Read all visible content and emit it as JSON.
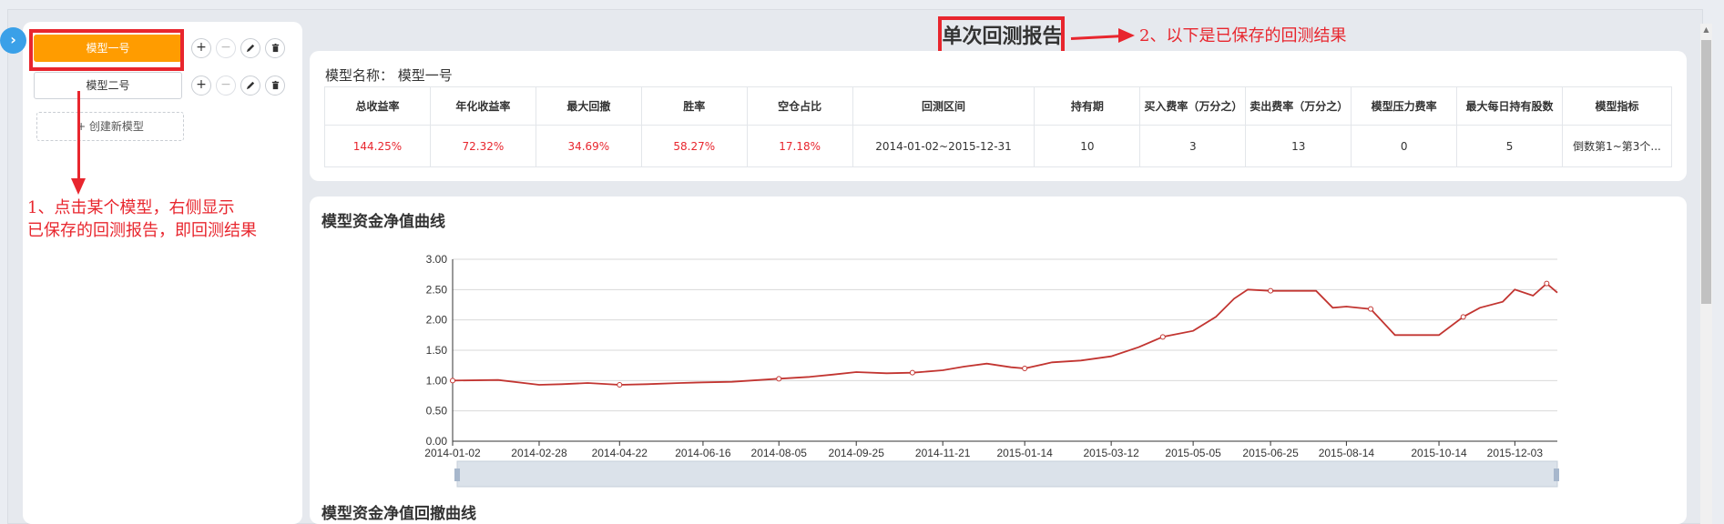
{
  "sidebar": {
    "models": [
      {
        "label": "模型一号",
        "active": true
      },
      {
        "label": "模型二号",
        "active": false
      }
    ],
    "create_label": "+ 创建新模型"
  },
  "annotations": {
    "left_line1": "1、点击某个模型，右侧显示",
    "left_line2": "已保存的回测报告，即回测结果",
    "top": "2、以下是已保存的回测结果"
  },
  "page_title": "单次回测报告",
  "report": {
    "model_name_label": "模型名称：",
    "model_name_value": "模型一号",
    "headers": [
      "总收益率",
      "年化收益率",
      "最大回撤",
      "胜率",
      "空仓占比",
      "回测区间",
      "持有期",
      "买入费率（万分之）",
      "卖出费率（万分之）",
      "模型压力费率",
      "最大每日持有股数",
      "模型指标"
    ],
    "values": [
      "144.25%",
      "72.32%",
      "34.69%",
      "58.27%",
      "17.18%",
      "2014-01-02~2015-12-31",
      "10",
      "3",
      "13",
      "0",
      "5",
      "倒数第1~第3个..."
    ]
  },
  "chart_title": "模型资金净值曲线",
  "drawdown_title": "模型资金净值回撤曲线",
  "colors": {
    "accent": "#ff9c00",
    "line": "#c23531",
    "annotation": "#e8262e",
    "toggle": "#3aa0e8"
  },
  "chart_data": {
    "type": "line",
    "title": "模型资金净值曲线",
    "xlabel": "",
    "ylabel": "",
    "ylim": [
      0,
      3
    ],
    "yticks": [
      "0.00",
      "0.50",
      "1.00",
      "1.50",
      "2.00",
      "2.50",
      "3.00"
    ],
    "xticks": [
      "2014-01-02",
      "2014-02-28",
      "2014-04-22",
      "2014-06-16",
      "2014-08-05",
      "2014-09-25",
      "2014-11-21",
      "2015-01-14",
      "2015-03-12",
      "2015-05-05",
      "2015-06-25",
      "2015-08-14",
      "2015-10-14",
      "2015-12-03"
    ],
    "grid": true,
    "series": [
      {
        "x": [
          "2014-01-02",
          "2014-02-01",
          "2014-02-28",
          "2014-03-15",
          "2014-04-01",
          "2014-04-22",
          "2014-05-10",
          "2014-06-01",
          "2014-06-16",
          "2014-07-05",
          "2014-08-05",
          "2014-08-25",
          "2014-09-10",
          "2014-09-25",
          "2014-10-15",
          "2014-11-01",
          "2014-11-21",
          "2014-12-05",
          "2014-12-20",
          "2015-01-05",
          "2015-01-14",
          "2015-02-01",
          "2015-02-20",
          "2015-03-12",
          "2015-03-30",
          "2015-04-15",
          "2015-05-05",
          "2015-05-20",
          "2015-06-01",
          "2015-06-10",
          "2015-06-25",
          "2015-07-10",
          "2015-07-25",
          "2015-08-05",
          "2015-08-14",
          "2015-08-30",
          "2015-09-15",
          "2015-09-28",
          "2015-10-08",
          "2015-10-14",
          "2015-10-30",
          "2015-11-10",
          "2015-11-25",
          "2015-12-03",
          "2015-12-15",
          "2015-12-24",
          "2015-12-31"
        ],
        "values": [
          1.0,
          1.01,
          0.93,
          0.94,
          0.96,
          0.93,
          0.94,
          0.96,
          0.97,
          0.98,
          1.03,
          1.06,
          1.1,
          1.14,
          1.12,
          1.13,
          1.17,
          1.23,
          1.28,
          1.22,
          1.2,
          1.3,
          1.33,
          1.4,
          1.55,
          1.72,
          1.82,
          2.05,
          2.35,
          2.5,
          2.48,
          2.48,
          2.48,
          2.2,
          2.22,
          2.18,
          1.75,
          1.75,
          1.75,
          1.75,
          2.05,
          2.2,
          2.3,
          2.5,
          2.4,
          2.6,
          2.45
        ]
      }
    ]
  }
}
